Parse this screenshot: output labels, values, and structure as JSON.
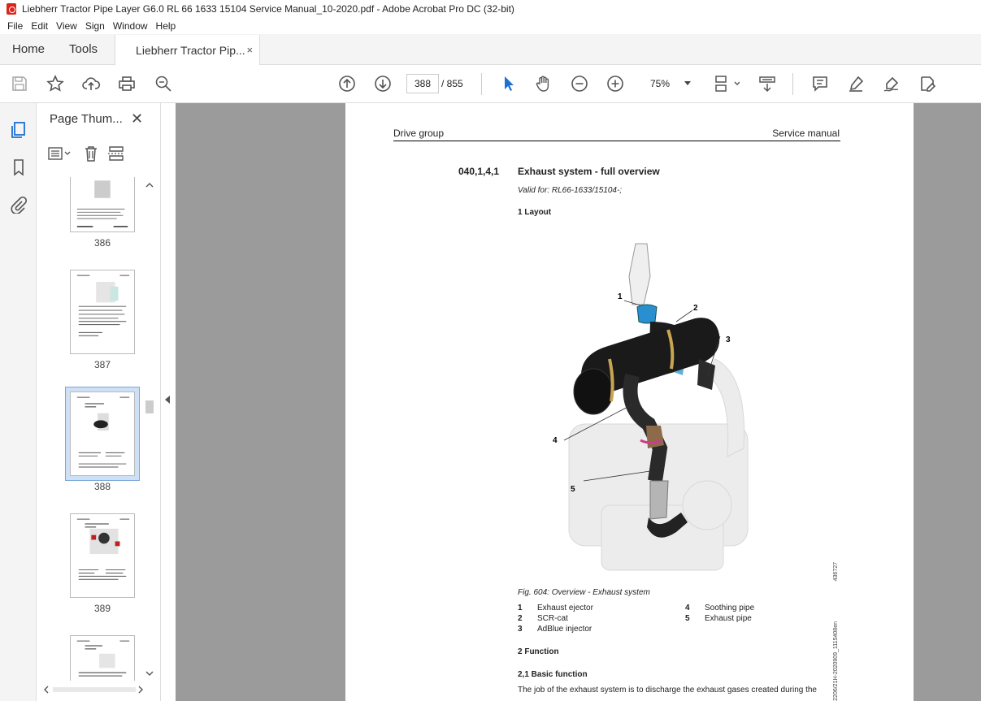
{
  "window": {
    "title": "Liebherr Tractor Pipe Layer G6.0 RL 66 1633 15104 Service Manual_10-2020.pdf - Adobe Acrobat Pro DC (32-bit)"
  },
  "menu": [
    "File",
    "Edit",
    "View",
    "Sign",
    "Window",
    "Help"
  ],
  "tabs": {
    "home": "Home",
    "tools": "Tools",
    "document": "Liebherr Tractor Pip...",
    "close": "×"
  },
  "toolbar": {
    "current_page": "388",
    "total_pages": "/ 855",
    "zoom": "75%"
  },
  "panel": {
    "title": "Page Thum...",
    "close": "✕",
    "thumbnails": [
      {
        "label": "386"
      },
      {
        "label": "387"
      },
      {
        "label": "388"
      },
      {
        "label": "389"
      },
      {
        "label": ""
      }
    ]
  },
  "document": {
    "header_left": "Drive group",
    "header_right": "Service manual",
    "section_number": "040,1,4,1",
    "section_title": "Exhaust system - full overview",
    "valid_for": "Valid for: RL66-1633/15104-;",
    "layout_heading": "1 Layout",
    "figure_caption": "Fig. 604: Overview - Exhaust system",
    "legend_left": [
      {
        "num": "1",
        "text": "Exhaust ejector"
      },
      {
        "num": "2",
        "text": "SCR-cat"
      },
      {
        "num": "3",
        "text": "AdBlue injector"
      }
    ],
    "legend_right": [
      {
        "num": "4",
        "text": "Soothing pipe"
      },
      {
        "num": "5",
        "text": "Exhaust pipe"
      }
    ],
    "callouts": [
      "1",
      "2",
      "3",
      "4",
      "5"
    ],
    "function_heading": "2 Function",
    "basic_function_heading": "2,1 Basic function",
    "body": "The job of the exhaust system is to discharge the exhaust gases created during the",
    "side_code_1": "436727",
    "side_code_2": "2206/21H-2020909_1115408en"
  }
}
